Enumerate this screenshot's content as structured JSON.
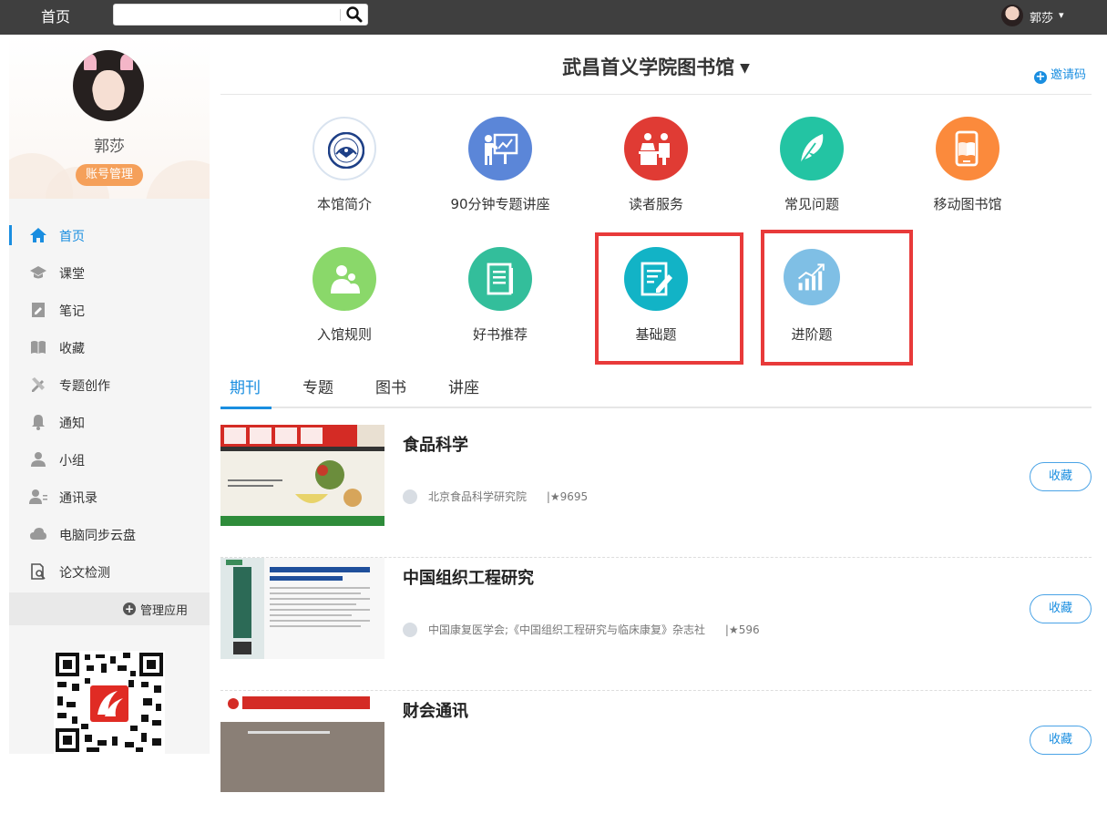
{
  "topbar": {
    "home": "首页",
    "search": {
      "value": "",
      "placeholder": ""
    },
    "user_name": "郭莎"
  },
  "sidebar": {
    "profile_name": "郭莎",
    "account_button": "账号管理",
    "nav": [
      {
        "label": "首页",
        "icon": "home-icon",
        "active": true
      },
      {
        "label": "课堂",
        "icon": "graduation-cap-icon"
      },
      {
        "label": "笔记",
        "icon": "note-icon"
      },
      {
        "label": "收藏",
        "icon": "book-open-icon"
      },
      {
        "label": "专题创作",
        "icon": "pencil-ruler-icon"
      },
      {
        "label": "通知",
        "icon": "bell-icon"
      },
      {
        "label": "小组",
        "icon": "user-icon"
      },
      {
        "label": "通讯录",
        "icon": "contacts-icon"
      },
      {
        "label": "电脑同步云盘",
        "icon": "cloud-icon"
      },
      {
        "label": "论文检测",
        "icon": "document-search-icon"
      }
    ],
    "manage_apps": "管理应用"
  },
  "main": {
    "library_title": "武昌首义学院图书馆",
    "invite": "邀请码",
    "apps": [
      {
        "label": "本馆简介",
        "icon": "school-emblem-icon"
      },
      {
        "label": "90分钟专题讲座",
        "icon": "presentation-icon",
        "color": "#5b86d8"
      },
      {
        "label": "读者服务",
        "icon": "service-desk-icon",
        "color": "#e03b34"
      },
      {
        "label": "常见问题",
        "icon": "feather-icon",
        "color": "#23c4a3"
      },
      {
        "label": "移动图书馆",
        "icon": "mobile-book-icon",
        "color": "#fb8a3c"
      },
      {
        "label": "入馆规则",
        "icon": "people-icon",
        "color": "#8ad86a"
      },
      {
        "label": "好书推荐",
        "icon": "book-icon",
        "color": "#33be9b"
      },
      {
        "label": "基础题",
        "icon": "edit-document-icon",
        "color": "#12b3c6"
      },
      {
        "label": "进阶题",
        "icon": "growth-chart-icon",
        "color": "#7fbfe5"
      }
    ],
    "tabs": [
      "期刊",
      "专题",
      "图书",
      "讲座"
    ],
    "journals": [
      {
        "title": "食品科学",
        "publisher": "北京食品科学研究院",
        "stars": "9695",
        "collect": "收藏"
      },
      {
        "title": "中国组织工程研究",
        "publisher": "中国康复医学会;《中国组织工程研究与临床康复》杂志社",
        "stars": "596",
        "collect": "收藏"
      },
      {
        "title": "财会通讯",
        "publisher": "",
        "stars": "",
        "collect": "收藏"
      }
    ]
  }
}
